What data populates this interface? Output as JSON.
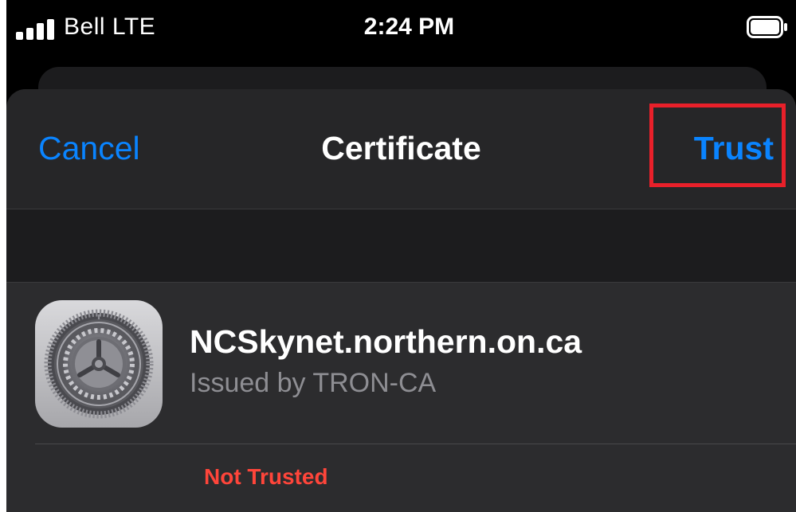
{
  "status_bar": {
    "carrier": "Bell  LTE",
    "time": "2:24 PM",
    "signal_icon": "signal-bars-icon",
    "battery_icon": "battery-icon"
  },
  "navbar": {
    "cancel_label": "Cancel",
    "title": "Certificate",
    "trust_label": "Trust"
  },
  "certificate": {
    "icon": "settings-gear-icon",
    "name": "NCSkynet.northern.on.ca",
    "issuer": "Issued by TRON-CA",
    "status": "Not Trusted"
  },
  "colors": {
    "accent": "#0a84ff",
    "danger": "#ff453a",
    "highlight": "#e8202a",
    "background": "#1c1c1e"
  }
}
